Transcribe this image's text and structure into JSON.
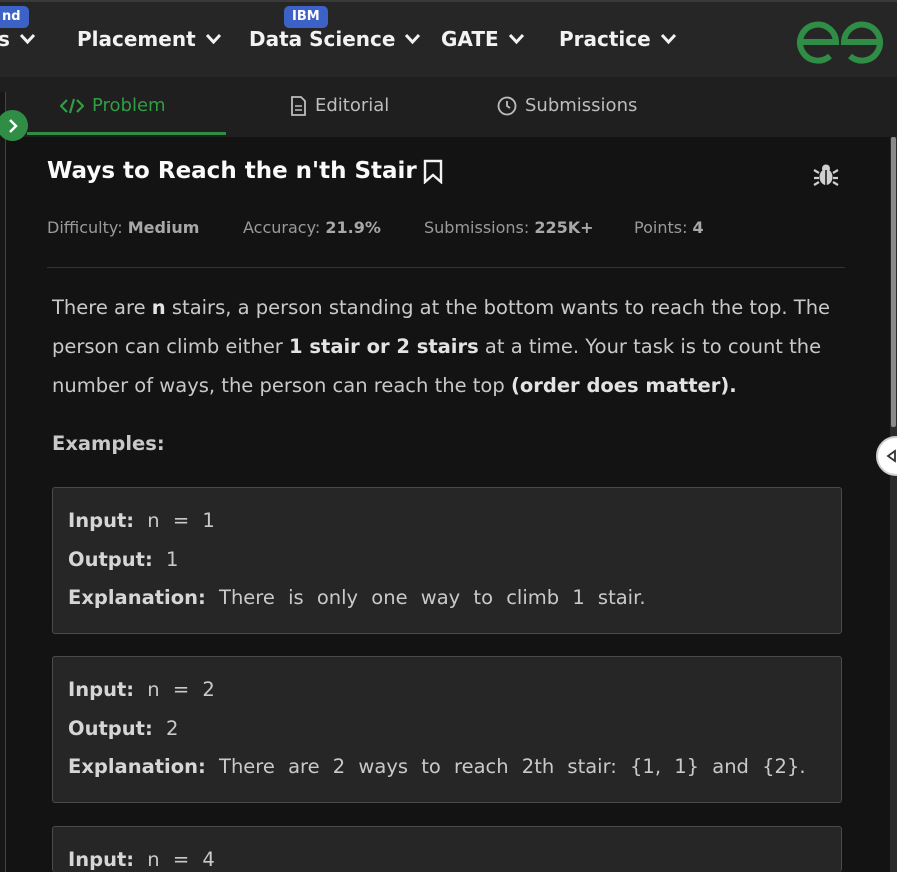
{
  "nav": {
    "badge_left": "nd",
    "items": [
      {
        "label": "s"
      },
      {
        "label": "Placement"
      },
      {
        "label": "Data Science"
      },
      {
        "label": "GATE"
      },
      {
        "label": "Practice"
      }
    ],
    "badge_ibm": "IBM",
    "logo": "geeksforgeeks-logo-icon"
  },
  "tabs": [
    {
      "label": "Problem",
      "icon": "code-icon",
      "active": true
    },
    {
      "label": "Editorial",
      "icon": "document-icon",
      "active": false
    },
    {
      "label": "Submissions",
      "icon": "clock-icon",
      "active": false
    }
  ],
  "problem": {
    "title": "Ways to Reach the n'th Stair",
    "meta": {
      "difficulty_label": "Difficulty:",
      "difficulty": "Medium",
      "accuracy_label": "Accuracy:",
      "accuracy": "21.9%",
      "submissions_label": "Submissions:",
      "submissions": "225K+",
      "points_label": "Points:",
      "points": "4"
    },
    "description": {
      "p1": "There are ",
      "b1": "n",
      "p2": " stairs, a person standing at the bottom wants to reach the top. The person can climb either ",
      "b2": "1 stair or 2 stairs",
      "p3": " at a time. Your task is to count the number of ways, the person can reach the top ",
      "b3": "(order does matter)."
    },
    "examples_heading": "Examples:",
    "examples": [
      {
        "input_label": "Input:",
        "input": " n = 1",
        "output_label": "Output:",
        "output": " 1",
        "explanation_label": "Explanation:",
        "explanation": " There is only one way to climb 1 stair."
      },
      {
        "input_label": "Input:",
        "input": " n = 2",
        "output_label": "Output:",
        "output": " 2",
        "explanation_label": "Explanation:",
        "explanation": " There are 2 ways to reach 2th stair: {1, 1} and {2}."
      },
      {
        "input_label": "Input:",
        "input": " n = 4"
      }
    ]
  },
  "colors": {
    "accent": "#2f8d46",
    "badge": "#3c62c7",
    "background": "#131313"
  }
}
